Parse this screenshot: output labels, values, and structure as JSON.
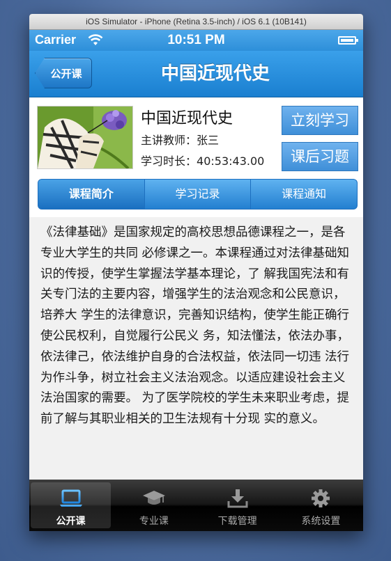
{
  "simulator": {
    "title": "iOS Simulator - iPhone (Retina 3.5-inch) / iOS 6.1 (10B141)"
  },
  "status_bar": {
    "carrier": "Carrier",
    "time": "10:51 PM"
  },
  "nav_bar": {
    "back_label": "公开课",
    "title": "中国近现代史"
  },
  "course": {
    "name": "中国近现代史",
    "teacher_label": "主讲教师：",
    "teacher": "张三",
    "duration_label": "学习时长：",
    "duration": "40:53:43.00",
    "study_button": "立刻学习",
    "exercise_button": "课后习题"
  },
  "segments": [
    {
      "label": "课程简介",
      "selected": true
    },
    {
      "label": "学习记录",
      "selected": false
    },
    {
      "label": "课程通知",
      "selected": false
    }
  ],
  "description": "《法律基础》是国家规定的高校思想品德课程之一，是各专业大学生的共同 必修课之一。本课程通过对法律基础知识的传授，使学生掌握法学基本理论，了 解我国宪法和有关专门法的主要内容，增强学生的法治观念和公民意识，培养大 学生的法律意识，完善知识结构，使学生能正确行使公民权利，自觉履行公民义 务，知法懂法，依法办事，依法律己，依法维护自身的合法权益，依法同一切违 法行为作斗争，树立社会主义法治观念。以适应建设社会主义法治国家的需要。 为了医学院校的学生未来职业考虑，提前了解与其职业相关的卫生法规有十分现 实的意义。",
  "tab_bar": [
    {
      "label": "公开课",
      "icon": "laptop-icon",
      "selected": true
    },
    {
      "label": "专业课",
      "icon": "graduation-cap-icon",
      "selected": false
    },
    {
      "label": "下载管理",
      "icon": "download-icon",
      "selected": false
    },
    {
      "label": "系统设置",
      "icon": "gear-icon",
      "selected": false
    }
  ],
  "colors": {
    "accent": "#2d8fd9",
    "tab_selected": "#2f9bf0"
  }
}
